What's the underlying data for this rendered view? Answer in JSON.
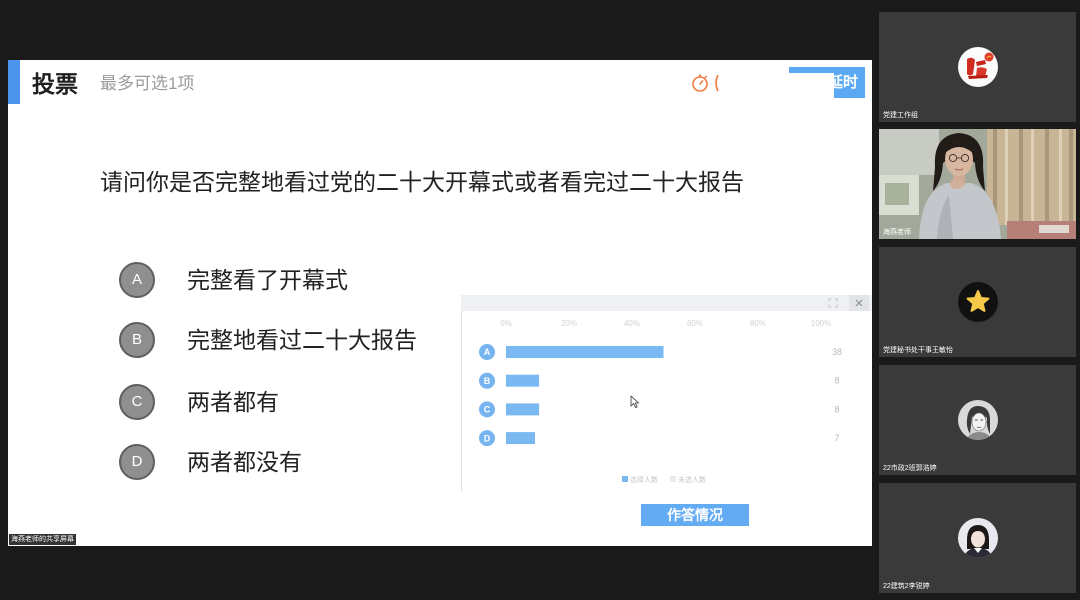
{
  "theme": {
    "accent": "#4d94ec",
    "timer": "#f07d41",
    "button": "#5ba8f3",
    "background": "#1a1a1a"
  },
  "screen_share": {
    "label": "海燕老师的共享屏幕"
  },
  "poll": {
    "title": "投票",
    "subtitle": "最多可选1项",
    "timer_icon": "stopwatch-icon",
    "extend_button": "延时",
    "question": "请问你是否完整地看过党的二十大开幕式或者看完过二十大报告",
    "options": [
      {
        "letter": "A",
        "text": "完整看了开幕式"
      },
      {
        "letter": "B",
        "text": "完整地看过二十大报告"
      },
      {
        "letter": "C",
        "text": "两者都有"
      },
      {
        "letter": "D",
        "text": "两者都没有"
      }
    ],
    "results_button": "作答情况"
  },
  "results_panel": {
    "icons": [
      "expand-icon",
      "close-icon"
    ]
  },
  "chart_data": {
    "type": "bar",
    "orientation": "horizontal",
    "categories": [
      "A",
      "B",
      "C",
      "D"
    ],
    "series": [
      {
        "name": "选择人数",
        "values": [
          50,
          10.5,
          10.5,
          9.2
        ],
        "color": "#7ab8f2"
      }
    ],
    "counts": [
      38,
      8,
      8,
      7
    ],
    "x_tick_labels": [
      "0%",
      "20%",
      "40%",
      "60%",
      "80%",
      "100%"
    ],
    "xlim": [
      0,
      100
    ],
    "legend": [
      {
        "label": "选择人数",
        "color": "#7ab8f2"
      },
      {
        "label": "未选人数",
        "color": "#e9ebef"
      }
    ],
    "legend_position": "bottom",
    "grid": false
  },
  "participants": [
    {
      "name": "党建工作组",
      "avatar": "party-emblem-avatar"
    },
    {
      "name": "海燕老师",
      "avatar": "camera-video-feed"
    },
    {
      "name": "党建秘书处干事王敏怡",
      "avatar": "star-avatar"
    },
    {
      "name": "22市政2班郭浩婷",
      "avatar": "sketch-portrait-avatar"
    },
    {
      "name": "22建筑2李锐婷",
      "avatar": "student-photo-avatar"
    }
  ]
}
